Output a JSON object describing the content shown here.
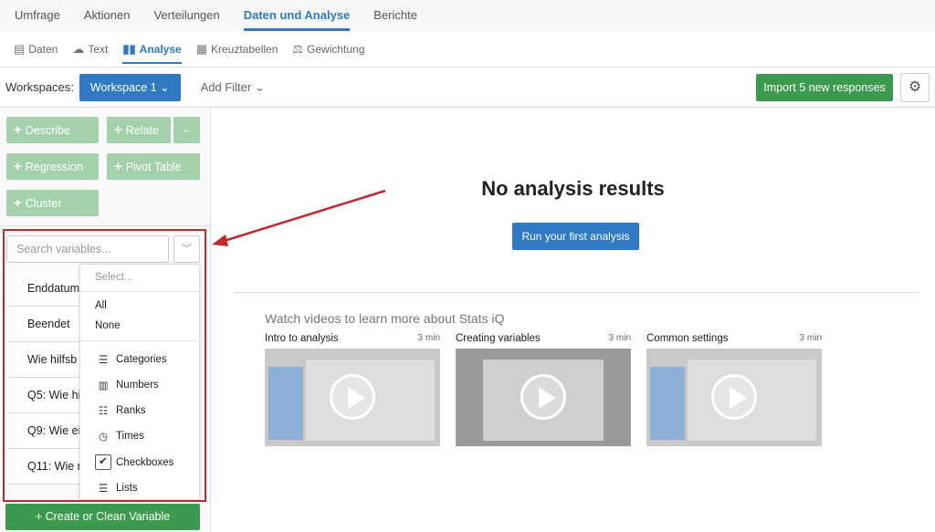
{
  "topnav": [
    "Umfrage",
    "Aktionen",
    "Verteilungen",
    "Daten und Analyse",
    "Berichte"
  ],
  "subnav": [
    {
      "icon": "comment-icon",
      "label": "Daten"
    },
    {
      "icon": "chat-icon",
      "label": "Text"
    },
    {
      "icon": "bar-chart-icon",
      "label": "Analyse"
    },
    {
      "icon": "grid-icon",
      "label": "Kreuztabellen"
    },
    {
      "icon": "scale-icon",
      "label": "Gewichtung"
    }
  ],
  "workspace": {
    "label": "Workspaces:",
    "selected": "Workspace 1",
    "add_filter": "Add Filter",
    "import": "Import 5 new responses"
  },
  "actions": {
    "describe": "Describe",
    "relate": "Relate",
    "regression": "Regression",
    "pivot": "Pivot Table",
    "cluster": "Cluster"
  },
  "search": {
    "placeholder": "Search variables..."
  },
  "variables": [
    "Enddatum",
    "Beendet",
    "Wie hilfsb",
    "Q5: Wie hi",
    "Q9: Wie ei",
    "Q11: Wie n"
  ],
  "menu": {
    "placeholder": "Select...",
    "all": "All",
    "none": "None",
    "types": [
      "Categories",
      "Numbers",
      "Ranks",
      "Times",
      "Checkboxes",
      "Lists"
    ]
  },
  "create": "Create or Clean Variable",
  "main": {
    "empty": "No analysis results",
    "run": "Run your first analysis",
    "watch": "Watch videos to learn more about Stats iQ",
    "videos": [
      {
        "title": "Intro to analysis",
        "duration": "3 min"
      },
      {
        "title": "Creating variables",
        "duration": "3 min"
      },
      {
        "title": "Common settings",
        "duration": "3 min"
      }
    ]
  },
  "colors": {
    "accent": "#2f7ac2",
    "green": "#3c9a4e",
    "highlight": "#c0282e"
  }
}
